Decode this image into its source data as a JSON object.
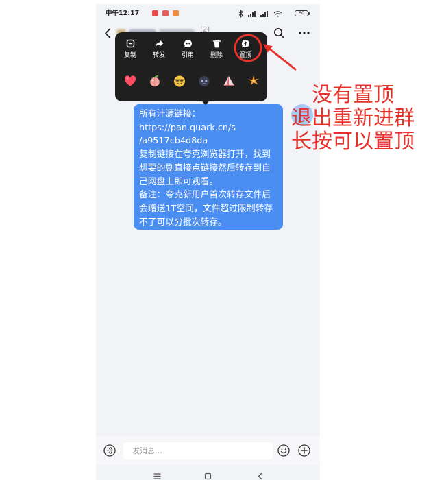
{
  "status_bar": {
    "time": "中午12:17",
    "battery_level": "60",
    "notification_colors": [
      "#e84a4a",
      "#e35d5d",
      "#f08a3c"
    ],
    "icons": [
      "bluetooth-icon",
      "signal-icon",
      "wifi-icon",
      "battery-icon"
    ]
  },
  "header": {
    "member_count": "(2)",
    "icons": [
      "chevron-left-icon",
      "search-icon",
      "more-icon"
    ]
  },
  "context_menu": {
    "actions": [
      {
        "label": "复制",
        "icon": "copy-icon"
      },
      {
        "label": "转发",
        "icon": "forward-icon"
      },
      {
        "label": "引用",
        "icon": "quote-icon"
      },
      {
        "label": "删除",
        "icon": "trash-icon"
      },
      {
        "label": "置顶",
        "icon": "pin-icon"
      }
    ],
    "reactions": [
      "heart-emoji",
      "peach-emoji",
      "grin-emoji",
      "dark-face-emoji",
      "cone-emoji",
      "sparkle-emoji"
    ]
  },
  "message": {
    "lines": [
      "所有汁源链接：",
      "https://pan.quark.cn/s",
      "/a9517cb4d8da",
      "复制链接在夸克浏览器打开，找到",
      "想要的剧直接点链接然后转存到自",
      "己网盘上即可观看。",
      "备注：夸克新用户首次转存文件后",
      "会赠送1T空间，文件超过限制转存",
      "不了可以分批次转存。"
    ]
  },
  "annotation": {
    "lines": [
      "没有置顶",
      "退出重新进群",
      "长按可以置顶"
    ],
    "color": "#e5332c"
  },
  "input_bar": {
    "placeholder": "发消息…",
    "icons": [
      "voice-icon",
      "emoji-icon",
      "plus-icon"
    ]
  },
  "nav_bar": {
    "icons": [
      "menu-icon",
      "home-icon",
      "back-icon"
    ]
  },
  "colors": {
    "chat_background": "#f2f3f7",
    "bubble": "#4b8ef1",
    "menu": "#1f1f1f",
    "accent_red": "#e5332c"
  }
}
